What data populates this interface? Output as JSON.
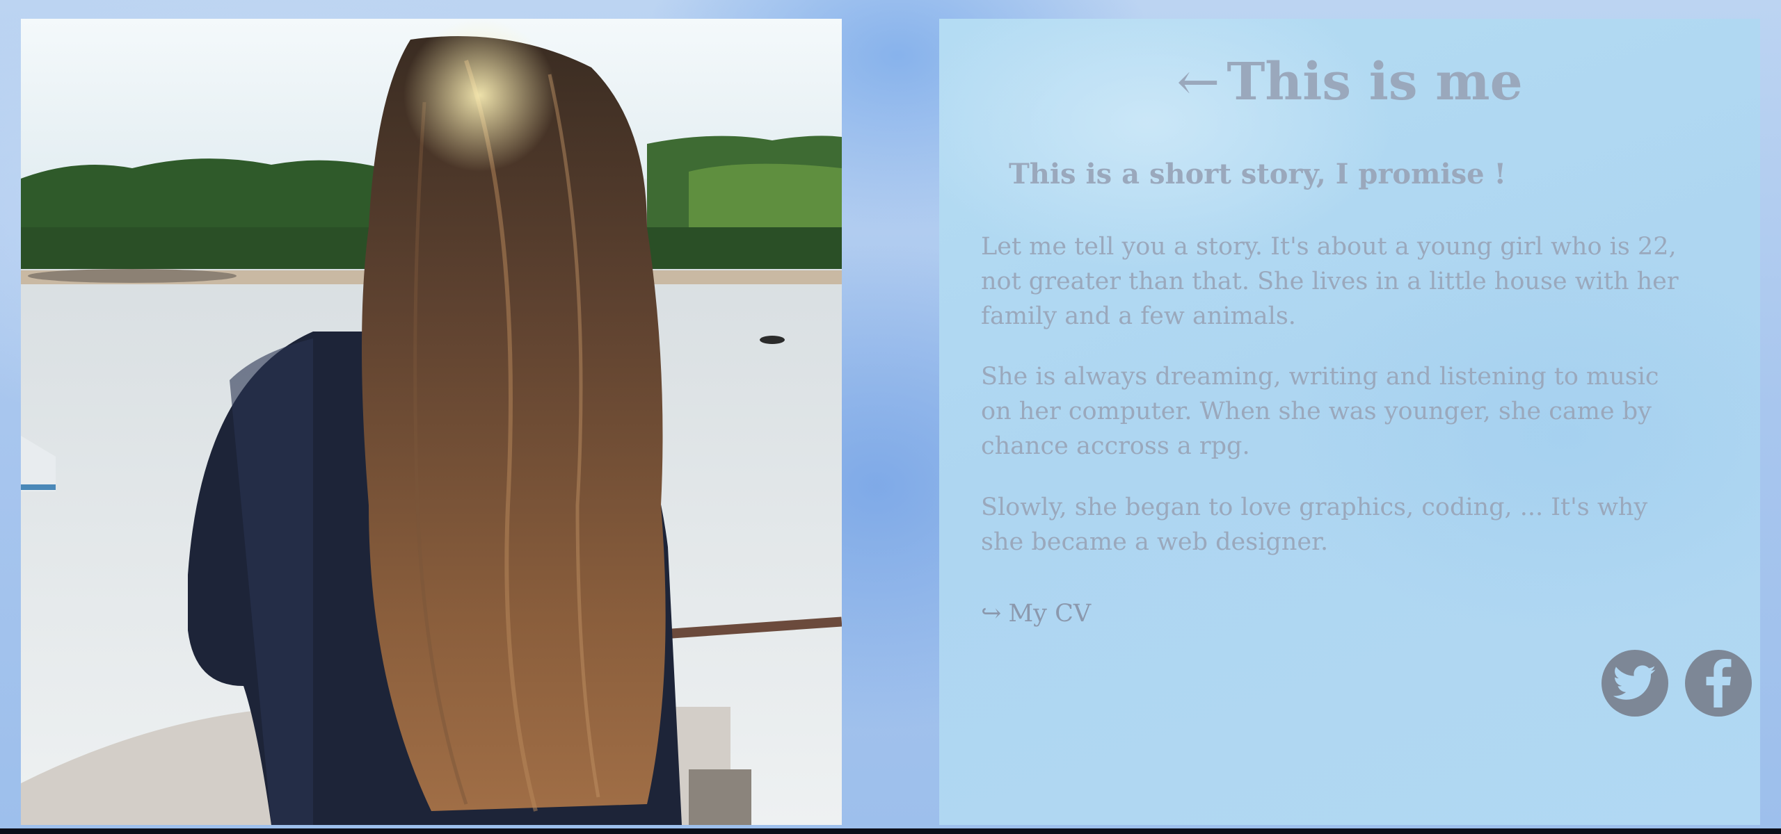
{
  "photo": {
    "alt": "Girl with long hair looking at the sea"
  },
  "about": {
    "back_arrow": "←",
    "title": "This is me",
    "subtitle": "This is a short story, I promise !",
    "paragraphs": [
      "Let me tell you a story. It's about a young girl who is 22, not greater than that. She lives in a little house with her family and a few animals.",
      "She is always dreaming, writing and listening to music on her computer. When she was younger, she came by chance accross a rpg.",
      "Slowly, she began to love graphics, coding, ... It's why she became a web designer."
    ],
    "cv_arrow": "↪",
    "cv_label": "My CV"
  },
  "social": {
    "twitter_icon": "twitter-bird-icon",
    "facebook_icon": "facebook-f-icon",
    "icon_bg": "#7d8796"
  },
  "colors": {
    "text": "#9aa8bc",
    "panel": "#b1d8f3",
    "background": "#a8c6ee"
  }
}
